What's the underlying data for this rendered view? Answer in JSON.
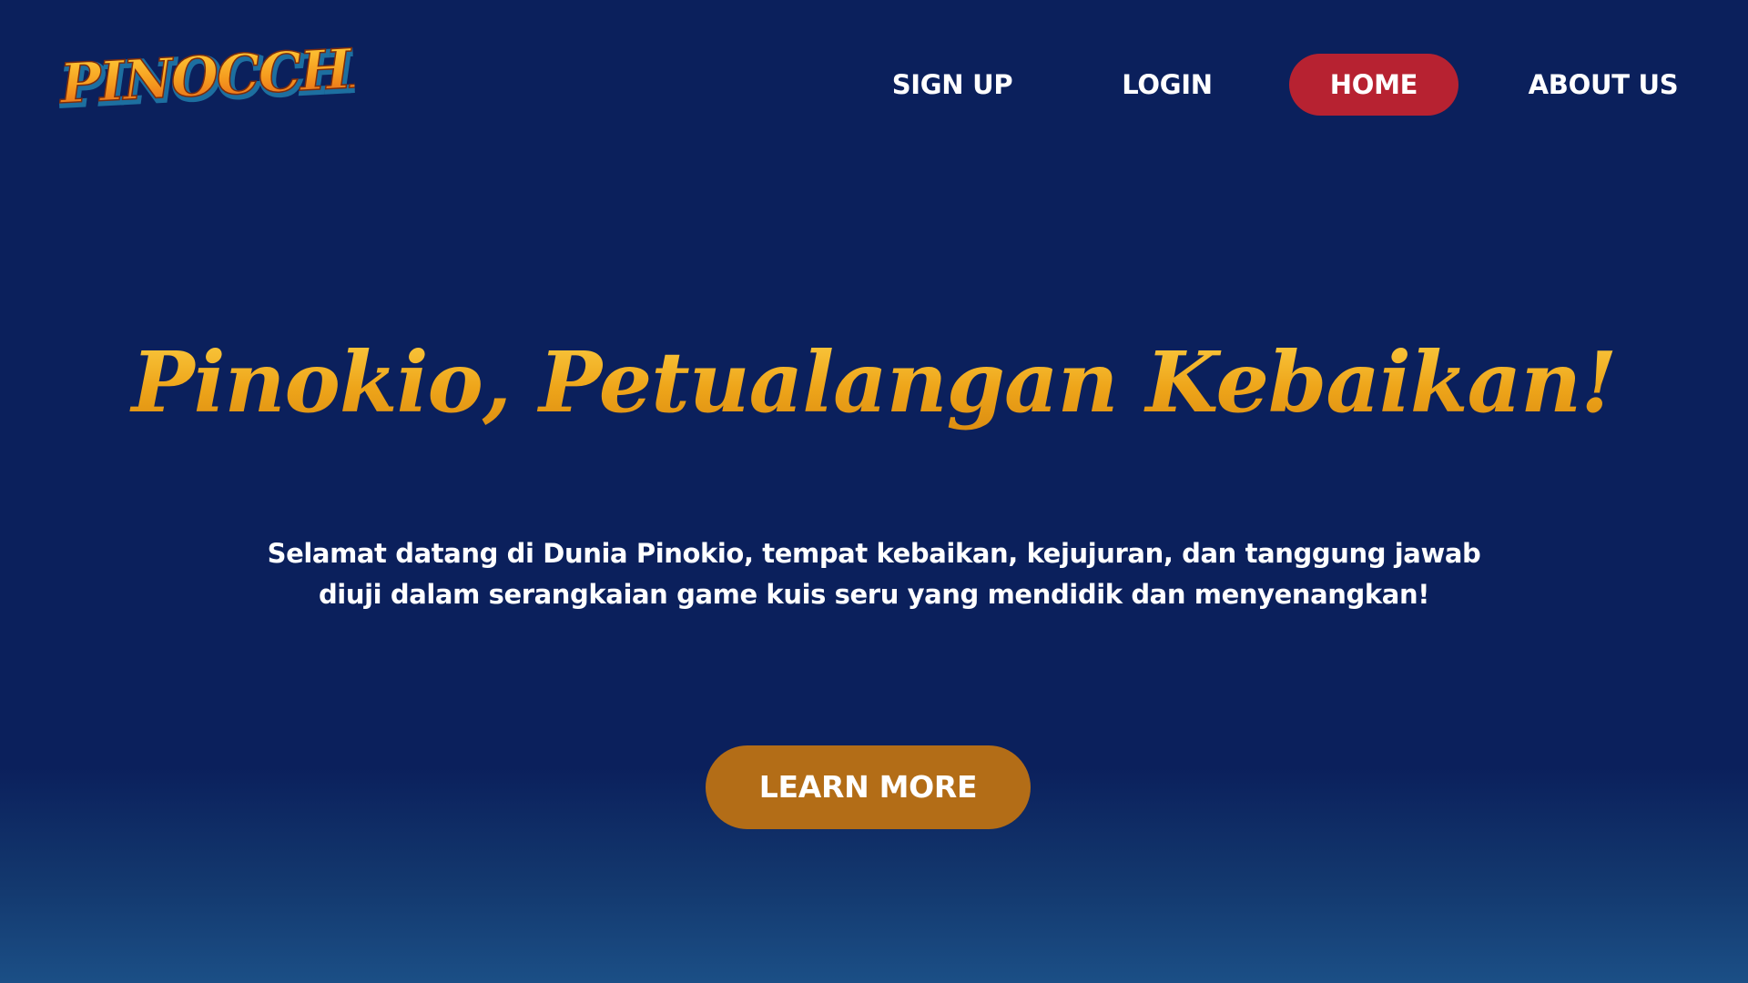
{
  "brand": {
    "logo_text": "PINOCCHIO"
  },
  "nav": {
    "items": [
      {
        "label": "SIGN UP"
      },
      {
        "label": "LOGIN"
      },
      {
        "label": "HOME"
      },
      {
        "label": "ABOUT US"
      }
    ],
    "active": "HOME"
  },
  "hero": {
    "title": "Pinokio, Petualangan Kebaikan!",
    "description": "Selamat datang di Dunia Pinokio, tempat kebaikan, kejujuran, dan tanggung jawab diuji dalam serangkaian game kuis seru yang mendidik dan menyenangkan!",
    "cta_label": "LEARN MORE"
  },
  "colors": {
    "background": "#0b205c",
    "active_nav": "#b72231",
    "cta": "#b36d17",
    "title_gold": "#f0a81c"
  }
}
